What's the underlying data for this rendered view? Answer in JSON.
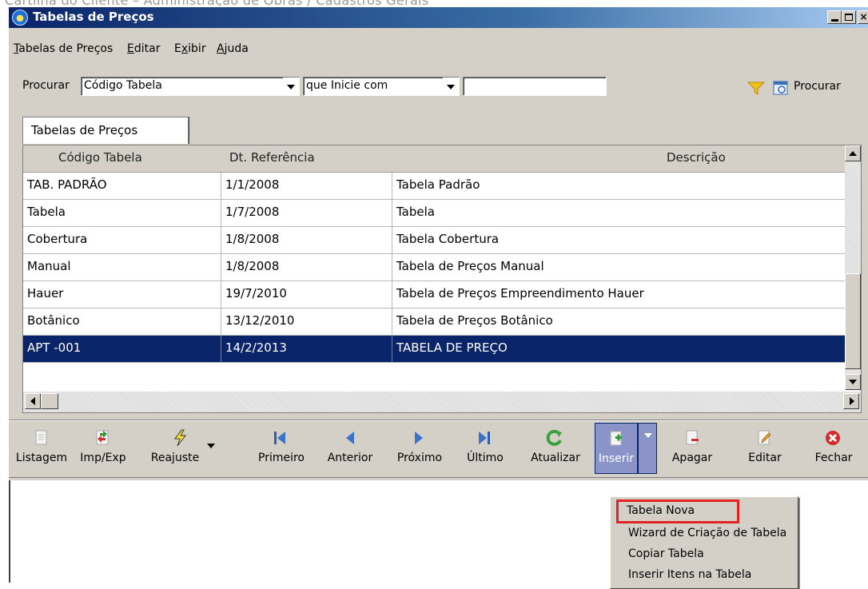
{
  "breadcrumb": "Cartilha do Cliente – Administração de Obras / Cadastros Gerais",
  "window": {
    "title": "Tabelas de Preços"
  },
  "menubar": [
    {
      "label": "Tabelas de Preços",
      "mnemonic": "T"
    },
    {
      "label": "Editar",
      "mnemonic": "E"
    },
    {
      "label": "Exibir",
      "mnemonic": "x"
    },
    {
      "label": "Ajuda",
      "mnemonic": "A"
    }
  ],
  "search": {
    "label": "Procurar",
    "field": "Código Tabela",
    "operator": "que Inicie com",
    "value": "",
    "button": "Procurar"
  },
  "tab": {
    "label": "Tabelas de Preços"
  },
  "grid": {
    "columns": [
      "Código Tabela",
      "Dt. Referência",
      "Descrição"
    ],
    "rows": [
      [
        "TAB. PADRÃO",
        "1/1/2008",
        "Tabela Padrão"
      ],
      [
        "Tabela",
        "1/7/2008",
        "Tabela"
      ],
      [
        "Cobertura",
        "1/8/2008",
        "Tabela Cobertura"
      ],
      [
        "Manual",
        "1/8/2008",
        "Tabela de Preços Manual"
      ],
      [
        "Hauer",
        "19/7/2010",
        "Tabela de Preços Empreendimento Hauer"
      ],
      [
        "Botânico",
        "13/12/2010",
        "Tabela de Preços Botânico"
      ],
      [
        "APT -001",
        "14/2/2013",
        "TABELA DE PREÇO"
      ]
    ],
    "selected_row": 6
  },
  "toolbar": [
    {
      "label": "Listagem",
      "icon": "list-icon"
    },
    {
      "label": "Imp/Exp",
      "icon": "import-export-icon"
    },
    {
      "label": "Reajuste",
      "icon": "lightning-icon"
    },
    {
      "label": "Primeiro",
      "icon": "first-icon"
    },
    {
      "label": "Anterior",
      "icon": "previous-icon"
    },
    {
      "label": "Próximo",
      "icon": "next-icon"
    },
    {
      "label": "Último",
      "icon": "last-icon"
    },
    {
      "label": "Atualizar",
      "icon": "refresh-icon"
    },
    {
      "label": "Inserir",
      "icon": "insert-icon"
    },
    {
      "label": "Apagar",
      "icon": "delete-icon"
    },
    {
      "label": "Editar",
      "icon": "edit-icon"
    },
    {
      "label": "Fechar",
      "icon": "close-circle-icon"
    }
  ],
  "insert_menu": [
    "Tabela Nova",
    "Wizard de Criação de Tabela",
    "Copiar Tabela",
    "Inserir Itens na Tabela"
  ],
  "colors": {
    "selection": "#0a246a",
    "highlight_outline": "#e02424",
    "titlebar": "#0a246a"
  }
}
